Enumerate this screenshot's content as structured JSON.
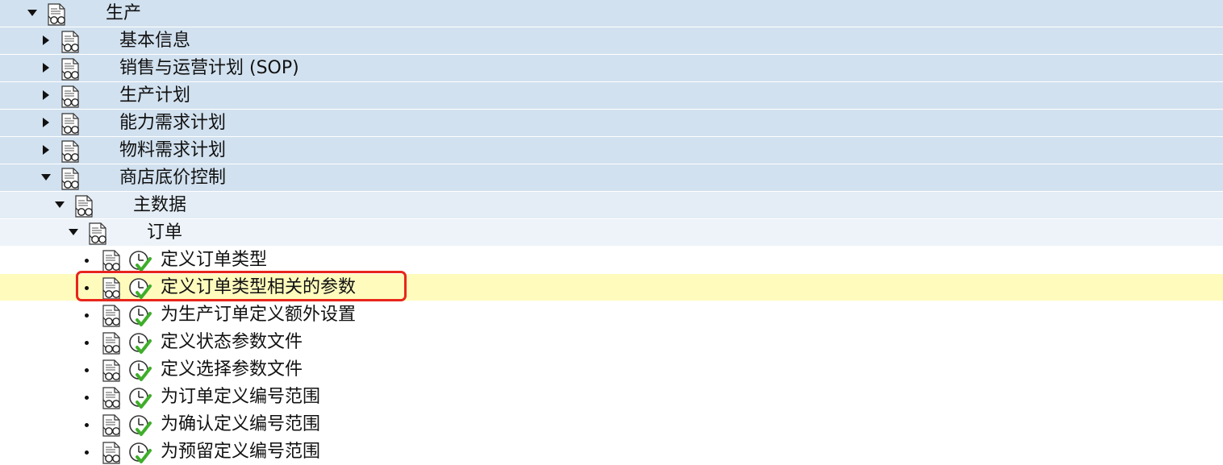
{
  "tree": {
    "root": {
      "label": "生产",
      "expanded": true
    },
    "level1": [
      {
        "label": "基本信息",
        "expanded": false
      },
      {
        "label": "销售与运营计划 (SOP)",
        "expanded": false
      },
      {
        "label": "生产计划",
        "expanded": false
      },
      {
        "label": "能力需求计划",
        "expanded": false
      },
      {
        "label": "物料需求计划",
        "expanded": false
      },
      {
        "label": "商店底价控制",
        "expanded": true
      }
    ],
    "level2": {
      "label": "主数据",
      "expanded": true
    },
    "level3": {
      "label": "订单",
      "expanded": true
    },
    "leaves": [
      {
        "label": "定义订单类型"
      },
      {
        "label": "定义订单类型相关的参数",
        "selected": true
      },
      {
        "label": "为生产订单定义额外设置"
      },
      {
        "label": "定义状态参数文件"
      },
      {
        "label": "定义选择参数文件"
      },
      {
        "label": "为订单定义编号范围"
      },
      {
        "label": "为确认定义编号范围"
      },
      {
        "label": "为预留定义编号范围"
      }
    ]
  },
  "colors": {
    "row_blue": "#d2e1ef",
    "row_light": "#e4edf6",
    "highlight": "#fffbbd",
    "annotation_box": "#e8251b",
    "exec_check": "#3fae2a"
  },
  "icons": {
    "node_icon": "document-glasses-icon",
    "execute_icon": "clock-check-icon"
  }
}
